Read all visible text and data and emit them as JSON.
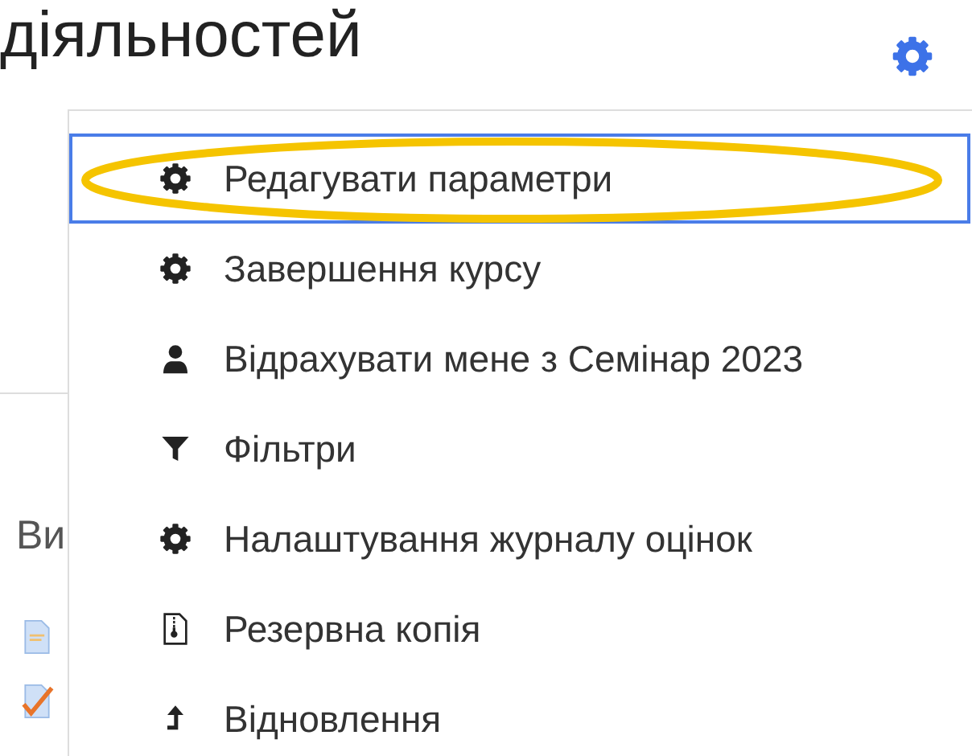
{
  "heading": "діяльностей",
  "page_behind": {
    "section_label": "Ви",
    "activity_icons": [
      {
        "kind": "page"
      },
      {
        "kind": "assignment"
      }
    ]
  },
  "menu": {
    "items": [
      {
        "kind": "gear",
        "label": "Редагувати параметри",
        "selected": true,
        "circled": true
      },
      {
        "kind": "gear",
        "label": "Завершення курсу",
        "selected": false,
        "circled": false
      },
      {
        "kind": "user",
        "label": "Відрахувати мене з Семінар 2023",
        "selected": false,
        "circled": false
      },
      {
        "kind": "filter",
        "label": "Фільтри",
        "selected": false,
        "circled": false
      },
      {
        "kind": "gear",
        "label": "Налаштування журналу оцінок",
        "selected": false,
        "circled": false
      },
      {
        "kind": "archive",
        "label": "Резервна копія",
        "selected": false,
        "circled": false
      },
      {
        "kind": "upload",
        "label": "Відновлення",
        "selected": false,
        "circled": false
      }
    ]
  }
}
